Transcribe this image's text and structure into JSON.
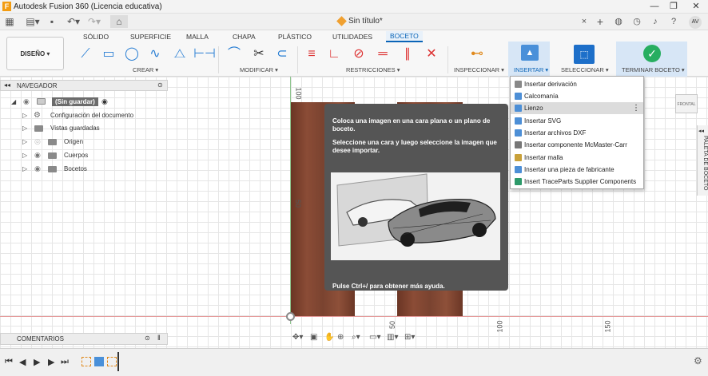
{
  "titlebar": {
    "logo": "F",
    "title": "Autodesk Fusion 360 (Licencia educativa)",
    "minimize": "—",
    "maximize": "❐",
    "close": "✕"
  },
  "qabar": {
    "doc_title": "Sin título*",
    "close_tab": "×",
    "new_tab": "+",
    "avatar": "AV"
  },
  "ribbon": {
    "tabs": [
      "SÓLIDO",
      "SUPERFICIE",
      "MALLA",
      "CHAPA",
      "PLÁSTICO",
      "UTILIDADES"
    ],
    "active_tab": "BOCETO",
    "workspace": "DISEÑO ▾",
    "groups": {
      "create": "CREAR ▾",
      "modify": "MODIFICAR ▾",
      "constraints": "RESTRICCIONES ▾",
      "inspect": "INSPECCIONAR ▾",
      "insert": "INSERTAR ▾",
      "select": "SELECCIONAR ▾",
      "finish": "TERMINAR BOCETO ▾"
    }
  },
  "navigator": {
    "title": "NAVEGADOR",
    "root": "(Sin guardar)",
    "items": [
      "Configuración del documento",
      "Vistas guardadas",
      "Origen",
      "Cuerpos",
      "Bocetos"
    ]
  },
  "comments": {
    "title": "COMENTARIOS"
  },
  "ruler": {
    "v100": "100",
    "v50": "50",
    "h50": "50",
    "h100": "100",
    "h150": "150"
  },
  "tooltip": {
    "line1": "Coloca una imagen en una cara plana o un plano de boceto.",
    "line2": "Seleccione una cara y luego seleccione la imagen que desee importar.",
    "help": "Pulse Ctrl+/ para obtener más ayuda."
  },
  "insert_menu": {
    "items": [
      "Insertar derivación",
      "Calcomanía",
      "Lienzo",
      "Insertar SVG",
      "Insertar archivos DXF",
      "Insertar componente McMaster-Carr",
      "Insertar malla",
      "Insertar una pieza de fabricante",
      "Insert TraceParts Supplier Components"
    ],
    "more": "⋮"
  },
  "viewcube": {
    "label": "FRONTAL"
  },
  "palette": {
    "label": "PALETA DE BOCETO"
  },
  "colors": {
    "accent": "#0a64b7",
    "finish": "#27ae60",
    "wood": "#8b4c36",
    "tooltip_bg": "#555555"
  }
}
